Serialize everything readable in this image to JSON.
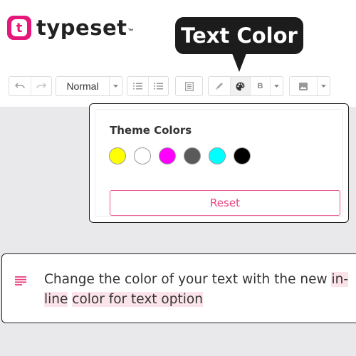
{
  "brand": {
    "logo_letter": "t",
    "name": "typeset",
    "trademark": "™",
    "accent_color": "#e6177a"
  },
  "tooltip": {
    "label": "Text Color"
  },
  "toolbar": {
    "undo_icon": "undo-icon",
    "redo_icon": "redo-icon",
    "block_style": "Normal",
    "bullet_list_icon": "bullet-list-icon",
    "numbered_list_icon": "numbered-list-icon",
    "block_format_icon": "paragraph-block-icon",
    "highlight_icon": "highlighter-icon",
    "text_color_icon": "palette-icon",
    "bold_label": "B",
    "image_icon": "image-icon"
  },
  "color_picker": {
    "title": "Theme Colors",
    "colors": [
      "#ffff00",
      "#ffffff",
      "#ff00ff",
      "#5a5a5a",
      "#00ffff",
      "#000000"
    ],
    "reset_label": "Reset"
  },
  "editor": {
    "paragraph_icon": "paragraph-icon",
    "text_plain": "Change the color of your text with the new ",
    "text_highlighted_1": "in-line",
    "text_highlighted_2": "color for text option",
    "highlight_color": "#fbe3ea"
  }
}
